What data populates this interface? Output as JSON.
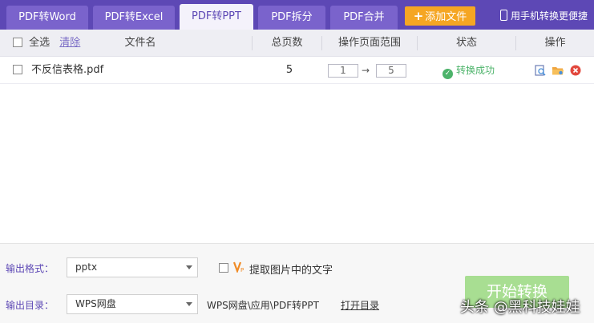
{
  "tabs": [
    {
      "label": "PDF转Word"
    },
    {
      "label": "PDF转Excel"
    },
    {
      "label": "PDF转PPT"
    },
    {
      "label": "PDF拆分"
    },
    {
      "label": "PDF合并"
    }
  ],
  "toolbar": {
    "add_file_label": "添加文件",
    "mobile_label": "用手机转换更便捷"
  },
  "table": {
    "headers": {
      "select_all": "全选",
      "clear": "清除",
      "filename": "文件名",
      "total_pages": "总页数",
      "page_range": "操作页面范围",
      "status": "状态",
      "operation": "操作"
    },
    "rows": [
      {
        "filename": "不反信表格.pdf",
        "total_pages": "5",
        "range_from": "1",
        "range_to": "5",
        "status": "转换成功"
      }
    ]
  },
  "output": {
    "format_label": "输出格式：",
    "format_value": "pptx",
    "extract_text_label": "提取图片中的文字",
    "dir_label": "输出目录：",
    "dir_value": "WPS网盘",
    "dir_path": "WPS网盘\\应用\\PDF转PPT",
    "open_dir_label": "打开目录"
  },
  "start_button_label": "开始转换",
  "watermark": "头条 @黑科技娃娃",
  "colors": {
    "brand": "#5d48b5",
    "add_button": "#f5a623",
    "success": "#4cb36a",
    "start_button": "#a8de92"
  }
}
